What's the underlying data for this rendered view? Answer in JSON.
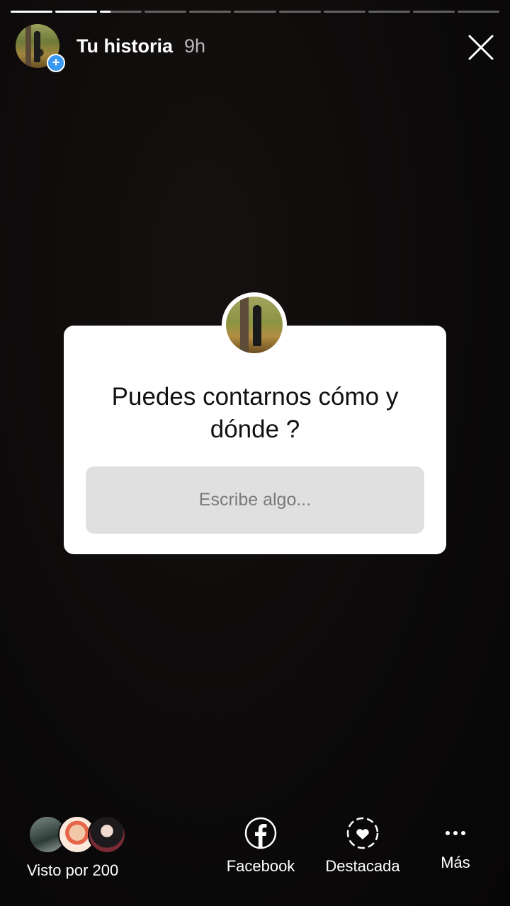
{
  "header": {
    "title": "Tu historia",
    "time": "9h",
    "add_badge": "+"
  },
  "progress": {
    "segments": 11,
    "current_index": 2,
    "current_fill": 0.25
  },
  "question_sticker": {
    "question": "Puedes contarnos cómo y dónde ?",
    "placeholder": "Escribe algo..."
  },
  "footer": {
    "seen_label": "Visto por 200",
    "actions": [
      {
        "label": "Facebook",
        "icon": "facebook-icon"
      },
      {
        "label": "Destacada",
        "icon": "highlight-heart-icon"
      },
      {
        "label": "Más",
        "icon": "more-dots-icon"
      }
    ]
  },
  "colors": {
    "background": "#0b0909",
    "accent_blue": "#3897f0",
    "card": "#ffffff",
    "input_bg": "#e0e0e0"
  }
}
